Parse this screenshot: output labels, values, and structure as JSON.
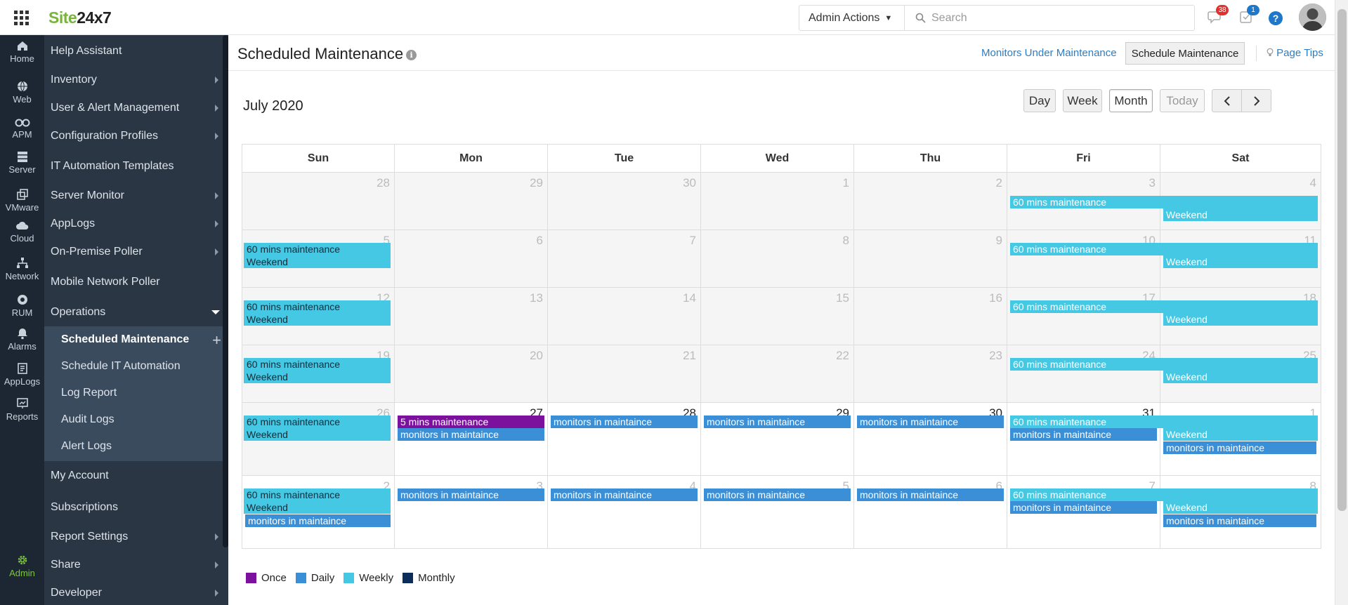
{
  "app": {
    "logo_site": "Site",
    "logo_num": "24x7"
  },
  "topbar": {
    "admin_actions": "Admin Actions",
    "search_placeholder": "Search",
    "alarms_badge": "38",
    "tasks_badge": "1",
    "help": "?",
    "colors": {
      "alarms_badge": "#e0312f",
      "tasks_badge": "#1f77c9",
      "help": "#1f77c9"
    }
  },
  "rail": [
    {
      "label": "Home",
      "icon": "home-icon"
    },
    {
      "label": "Web",
      "icon": "globe-icon"
    },
    {
      "label": "APM",
      "icon": "binoculars-icon"
    },
    {
      "label": "Server",
      "icon": "server-icon"
    },
    {
      "label": "VMware",
      "icon": "vmware-icon"
    },
    {
      "label": "Cloud",
      "icon": "cloud-icon"
    },
    {
      "label": "Network",
      "icon": "network-icon"
    },
    {
      "label": "RUM",
      "icon": "rum-icon"
    },
    {
      "label": "Alarms",
      "icon": "bell-icon"
    },
    {
      "label": "AppLogs",
      "icon": "applogs-icon"
    },
    {
      "label": "Reports",
      "icon": "reports-icon"
    },
    {
      "label": "Admin",
      "icon": "gear-icon"
    }
  ],
  "menu": {
    "items": [
      {
        "label": "Help Assistant"
      },
      {
        "label": "Inventory"
      },
      {
        "label": "User & Alert Management"
      },
      {
        "label": "Configuration Profiles"
      },
      {
        "label": "IT Automation Templates"
      },
      {
        "label": "Server Monitor"
      },
      {
        "label": "AppLogs"
      },
      {
        "label": "On-Premise Poller"
      },
      {
        "label": "Mobile Network Poller"
      },
      {
        "label": "Operations"
      },
      {
        "label": "My Account"
      },
      {
        "label": "Subscriptions"
      },
      {
        "label": "Report Settings"
      },
      {
        "label": "Share"
      },
      {
        "label": "Developer"
      }
    ],
    "sub": [
      {
        "label": "Scheduled Maintenance"
      },
      {
        "label": "Schedule IT Automation"
      },
      {
        "label": "Log Report"
      },
      {
        "label": "Audit Logs"
      },
      {
        "label": "Alert Logs"
      }
    ]
  },
  "header": {
    "title": "Scheduled Maintenance",
    "info": "i",
    "monitors_link": "Monitors Under Maintenance",
    "schedule_button": "Schedule Maintenance",
    "page_tips": "Page Tips"
  },
  "calendar": {
    "title": "July 2020",
    "views": {
      "day": "Day",
      "week": "Week",
      "month": "Month",
      "today": "Today"
    },
    "weekdays": [
      "Sun",
      "Mon",
      "Tue",
      "Wed",
      "Thu",
      "Fri",
      "Sat"
    ],
    "weeks": [
      [
        "28",
        "29",
        "30",
        "1",
        "2",
        "3",
        "4"
      ],
      [
        "5",
        "6",
        "7",
        "8",
        "9",
        "10",
        "11"
      ],
      [
        "12",
        "13",
        "14",
        "15",
        "16",
        "17",
        "18"
      ],
      [
        "19",
        "20",
        "21",
        "22",
        "23",
        "24",
        "25"
      ],
      [
        "26",
        "27",
        "28",
        "29",
        "30",
        "31",
        "1"
      ],
      [
        "2",
        "3",
        "4",
        "5",
        "6",
        "7",
        "8"
      ]
    ],
    "events": {
      "sixty": "60 mins maintenance",
      "weekend": "Weekend",
      "five": "5 mins maintenance",
      "monitors": "monitors in maintaince"
    }
  },
  "legend": [
    {
      "label": "Once",
      "color": "#7b119d"
    },
    {
      "label": "Daily",
      "color": "#3a8fd6"
    },
    {
      "label": "Weekly",
      "color": "#45c8e4"
    },
    {
      "label": "Monthly",
      "color": "#0c2d5a"
    }
  ]
}
